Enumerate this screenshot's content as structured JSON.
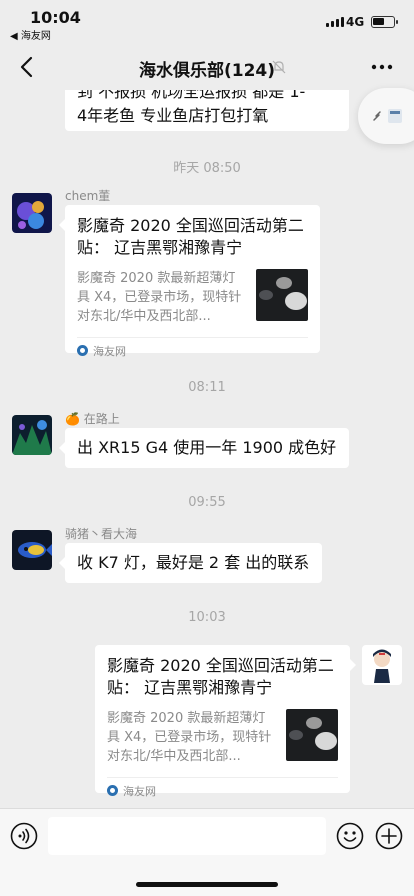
{
  "status_bar": {
    "time": "10:04",
    "back_app": "◀ 海友网",
    "network": "4G"
  },
  "nav": {
    "title": "海水俱乐部(124)"
  },
  "messages": {
    "partial": {
      "line1": "到 不报损 机场全运报损 都是 1-",
      "line2": "4年老鱼 专业鱼店打包打氧"
    },
    "stamp1": "昨天 08:50",
    "m1": {
      "sender": "chem董",
      "title": "影魔奇 2020 全国巡回活动第二贴： 辽吉黑鄂湘豫青宁",
      "desc": "影魔奇 2020 款最新超薄灯具 X4，已登录市场，现特针对东北/华中及西北部...",
      "source": "海友网"
    },
    "stamp2": "08:11",
    "m2": {
      "sender": "在路上",
      "sender_emoji": "🍊",
      "text": "出 XR15 G4 使用一年 1900 成色好"
    },
    "stamp3": "09:55",
    "m3": {
      "sender": "骑猪丶看大海",
      "text": "收 K7 灯，最好是 2 套 出的联系"
    },
    "stamp4": "10:03",
    "m4": {
      "title": "影魔奇 2020 全国巡回活动第二贴： 辽吉黑鄂湘豫青宁",
      "desc": "影魔奇 2020 款最新超薄灯具 X4，已登录市场，现特针对东北/华中及西北部...",
      "source": "海友网"
    }
  },
  "input": {
    "value": ""
  },
  "colors": {
    "background": "#ededed",
    "bubble": "#ffffff",
    "timestamp": "#a6a6a6"
  }
}
